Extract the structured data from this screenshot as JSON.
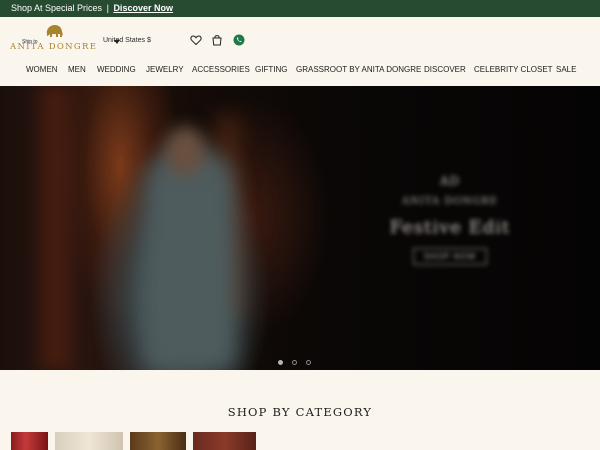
{
  "promo": {
    "text": "Shop At Special Prices",
    "separator": "|",
    "link": "Discover Now"
  },
  "header": {
    "brand": "ANITA DONGRE",
    "locale_label": "Ship to",
    "currency_label": "United States $",
    "icons": [
      "heart-icon",
      "cart-icon",
      "whatsapp-icon"
    ],
    "brand_color": "#a8842f",
    "whatsapp_color": "#1f7a4a"
  },
  "nav": {
    "items": [
      "WOMEN",
      "MEN",
      "WEDDING",
      "JEWELRY",
      "ACCESSORIES",
      "GIFTING",
      "GRASSROOT BY ANITA DONGRE",
      "DISCOVER",
      "CELEBRITY CLOSET",
      "SALE"
    ]
  },
  "hero": {
    "brand": "AD",
    "sub": "ANITA DONGRE",
    "title": "Festive Edit",
    "cta": "SHOP NOW",
    "slide_count": 3,
    "active_slide": 1
  },
  "category": {
    "heading": "SHOP BY CATEGORY"
  },
  "colors": {
    "promo_bg": "#274b31",
    "page_bg": "#faf6ee",
    "text": "#1e1e1e"
  }
}
